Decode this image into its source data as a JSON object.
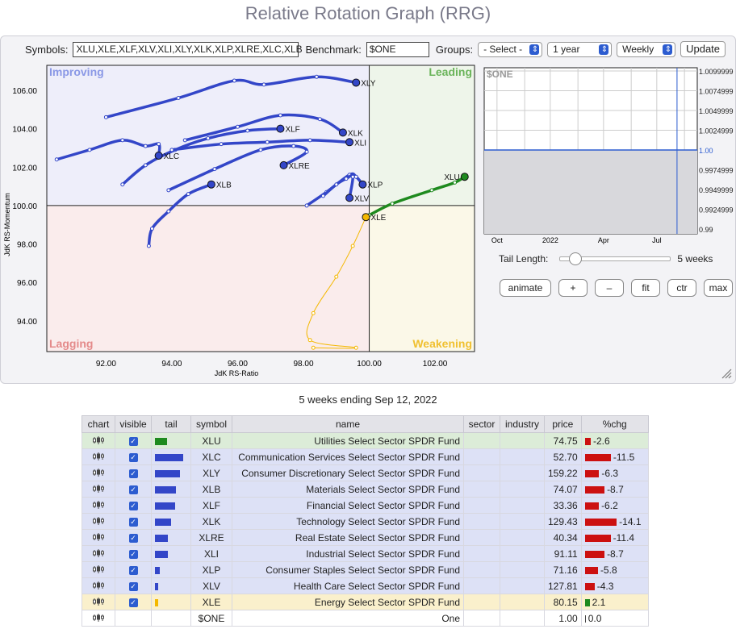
{
  "title": "Relative Rotation Graph (RRG)",
  "controls": {
    "symbols_label": "Symbols:",
    "symbols_value": "XLU,XLE,XLF,XLV,XLI,XLY,XLK,XLP,XLRE,XLC,XLB",
    "benchmark_label": "Benchmark:",
    "benchmark_value": "$ONE",
    "groups_label": "Groups:",
    "groups_value": "- Select -",
    "period_value": "1 year",
    "interval_value": "Weekly",
    "update_label": "Update"
  },
  "chart_data": {
    "type": "scatter",
    "xlabel": "JdK RS-Ratio",
    "ylabel": "JdK RS-Momentum",
    "xlim": [
      90.2,
      103.2
    ],
    "ylim": [
      92.4,
      107.3
    ],
    "x_ticks": [
      "92.00",
      "94.00",
      "96.00",
      "98.00",
      "100.00",
      "102.00"
    ],
    "y_ticks": [
      "94.00",
      "96.00",
      "98.00",
      "100.00",
      "102.00",
      "104.00",
      "106.00"
    ],
    "quadrants": {
      "improving": "Improving",
      "leading": "Leading",
      "lagging": "Lagging",
      "weakening": "Weakening"
    },
    "series": [
      {
        "name": "XLY",
        "color": "#3346c8",
        "points": [
          [
            92.0,
            104.6
          ],
          [
            94.2,
            105.6
          ],
          [
            95.9,
            106.5
          ],
          [
            96.8,
            106.3
          ],
          [
            98.4,
            106.7
          ],
          [
            99.6,
            106.4
          ]
        ]
      },
      {
        "name": "XLK",
        "color": "#3346c8",
        "points": [
          [
            94.4,
            103.4
          ],
          [
            96.0,
            104.1
          ],
          [
            97.3,
            104.7
          ],
          [
            98.5,
            104.5
          ],
          [
            99.2,
            103.8
          ]
        ]
      },
      {
        "name": "XLF",
        "color": "#3346c8",
        "points": [
          [
            92.5,
            101.1
          ],
          [
            93.2,
            102.1
          ],
          [
            94.1,
            102.9
          ],
          [
            95.1,
            103.5
          ],
          [
            96.3,
            103.9
          ],
          [
            97.3,
            104.0
          ]
        ]
      },
      {
        "name": "XLI",
        "color": "#3346c8",
        "points": [
          [
            94.0,
            102.9
          ],
          [
            95.5,
            103.2
          ],
          [
            96.9,
            103.3
          ],
          [
            98.2,
            103.4
          ],
          [
            99.4,
            103.3
          ]
        ]
      },
      {
        "name": "XLC",
        "color": "#3346c8",
        "points": [
          [
            90.5,
            102.4
          ],
          [
            91.5,
            102.9
          ],
          [
            92.5,
            103.4
          ],
          [
            93.2,
            103.1
          ],
          [
            93.6,
            103.2
          ],
          [
            93.6,
            102.6
          ]
        ]
      },
      {
        "name": "XLRE",
        "color": "#3346c8",
        "points": [
          [
            93.9,
            100.8
          ],
          [
            95.3,
            101.9
          ],
          [
            96.7,
            102.9
          ],
          [
            97.7,
            103.1
          ],
          [
            98.1,
            102.8
          ],
          [
            97.4,
            102.1
          ]
        ]
      },
      {
        "name": "XLB",
        "color": "#3346c8",
        "points": [
          [
            93.3,
            97.9
          ],
          [
            93.4,
            98.8
          ],
          [
            93.9,
            99.7
          ],
          [
            94.5,
            100.6
          ],
          [
            95.2,
            101.1
          ]
        ]
      },
      {
        "name": "XLP",
        "color": "#3346c8",
        "points": [
          [
            98.1,
            100.0
          ],
          [
            98.7,
            100.7
          ],
          [
            99.4,
            101.6
          ],
          [
            99.6,
            101.5
          ],
          [
            99.8,
            101.1
          ]
        ]
      },
      {
        "name": "XLV",
        "color": "#3346c8",
        "points": [
          [
            98.6,
            100.5
          ],
          [
            99.0,
            101.1
          ],
          [
            99.3,
            101.4
          ],
          [
            99.5,
            101.5
          ],
          [
            99.4,
            100.4
          ]
        ]
      },
      {
        "name": "XLU",
        "color": "#1e8a1e",
        "points": [
          [
            100.0,
            99.5
          ],
          [
            100.7,
            100.1
          ],
          [
            101.9,
            100.8
          ],
          [
            102.6,
            101.2
          ],
          [
            102.9,
            101.5
          ]
        ]
      },
      {
        "name": "XLE",
        "color": "#f4b800",
        "points": [
          [
            98.3,
            92.6
          ],
          [
            99.6,
            92.6
          ],
          [
            98.2,
            93.0
          ],
          [
            98.3,
            94.4
          ],
          [
            99.0,
            96.3
          ],
          [
            99.5,
            97.9
          ],
          [
            99.9,
            99.4
          ]
        ]
      }
    ]
  },
  "bench_chart": {
    "label": "$ONE",
    "y_ticks": [
      "1.0099999",
      "1.0074999",
      "1.0049999",
      "1.0024999",
      "1.00",
      "0.9974999",
      "0.9949999",
      "0.9924999",
      "0.99"
    ],
    "x_ticks": [
      "Oct",
      "2022",
      "Apr",
      "Jul"
    ],
    "value": 1.0
  },
  "tail": {
    "label": "Tail Length:",
    "value_label": "5 weeks",
    "value": 5,
    "max": 52
  },
  "buttons": {
    "animate": "animate",
    "plus": "+",
    "minus": "–",
    "fit": "fit",
    "ctr": "ctr",
    "max": "max"
  },
  "table": {
    "caption": "5 weeks ending Sep 12, 2022",
    "headers": [
      "chart",
      "visible",
      "tail",
      "symbol",
      "name",
      "sector",
      "industry",
      "price",
      "%chg"
    ],
    "rows": [
      {
        "symbol": "XLU",
        "name": "Utilities Select Sector SPDR Fund",
        "price": "74.75",
        "chg": "-2.6",
        "chgval": -2.6,
        "visible": true,
        "tail": 15,
        "tailColor": "#1e8a1e",
        "row": "green"
      },
      {
        "symbol": "XLC",
        "name": "Communication Services Select Sector SPDR Fund",
        "price": "52.70",
        "chg": "-11.5",
        "chgval": -11.5,
        "visible": true,
        "tail": 35,
        "tailColor": "#3346c8",
        "row": "blue"
      },
      {
        "symbol": "XLY",
        "name": "Consumer Discretionary Select Sector SPDR Fund",
        "price": "159.22",
        "chg": "-6.3",
        "chgval": -6.3,
        "visible": true,
        "tail": 31,
        "tailColor": "#3346c8",
        "row": "blue"
      },
      {
        "symbol": "XLB",
        "name": "Materials Select Sector SPDR Fund",
        "price": "74.07",
        "chg": "-8.7",
        "chgval": -8.7,
        "visible": true,
        "tail": 26,
        "tailColor": "#3346c8",
        "row": "blue"
      },
      {
        "symbol": "XLF",
        "name": "Financial Select Sector SPDR Fund",
        "price": "33.36",
        "chg": "-6.2",
        "chgval": -6.2,
        "visible": true,
        "tail": 25,
        "tailColor": "#3346c8",
        "row": "blue"
      },
      {
        "symbol": "XLK",
        "name": "Technology Select Sector SPDR Fund",
        "price": "129.43",
        "chg": "-14.1",
        "chgval": -14.1,
        "visible": true,
        "tail": 20,
        "tailColor": "#3346c8",
        "row": "blue"
      },
      {
        "symbol": "XLRE",
        "name": "Real Estate Select Sector SPDR Fund",
        "price": "40.34",
        "chg": "-11.4",
        "chgval": -11.4,
        "visible": true,
        "tail": 16,
        "tailColor": "#3346c8",
        "row": "blue"
      },
      {
        "symbol": "XLI",
        "name": "Industrial Select Sector SPDR Fund",
        "price": "91.11",
        "chg": "-8.7",
        "chgval": -8.7,
        "visible": true,
        "tail": 16,
        "tailColor": "#3346c8",
        "row": "blue"
      },
      {
        "symbol": "XLP",
        "name": "Consumer Staples Select Sector SPDR Fund",
        "price": "71.16",
        "chg": "-5.8",
        "chgval": -5.8,
        "visible": true,
        "tail": 6,
        "tailColor": "#3346c8",
        "row": "blue"
      },
      {
        "symbol": "XLV",
        "name": "Health Care Select Sector SPDR Fund",
        "price": "127.81",
        "chg": "-4.3",
        "chgval": -4.3,
        "visible": true,
        "tail": 4,
        "tailColor": "#3346c8",
        "row": "blue"
      },
      {
        "symbol": "XLE",
        "name": "Energy Select Sector SPDR Fund",
        "price": "80.15",
        "chg": "2.1",
        "chgval": 2.1,
        "visible": true,
        "tail": 4,
        "tailColor": "#f4b800",
        "row": "yellow"
      },
      {
        "symbol": "$ONE",
        "name": "One",
        "price": "1.00",
        "chg": "0.0",
        "chgval": 0,
        "visible": false,
        "tail": 0,
        "tailColor": "#3346c8",
        "row": "white"
      }
    ]
  }
}
